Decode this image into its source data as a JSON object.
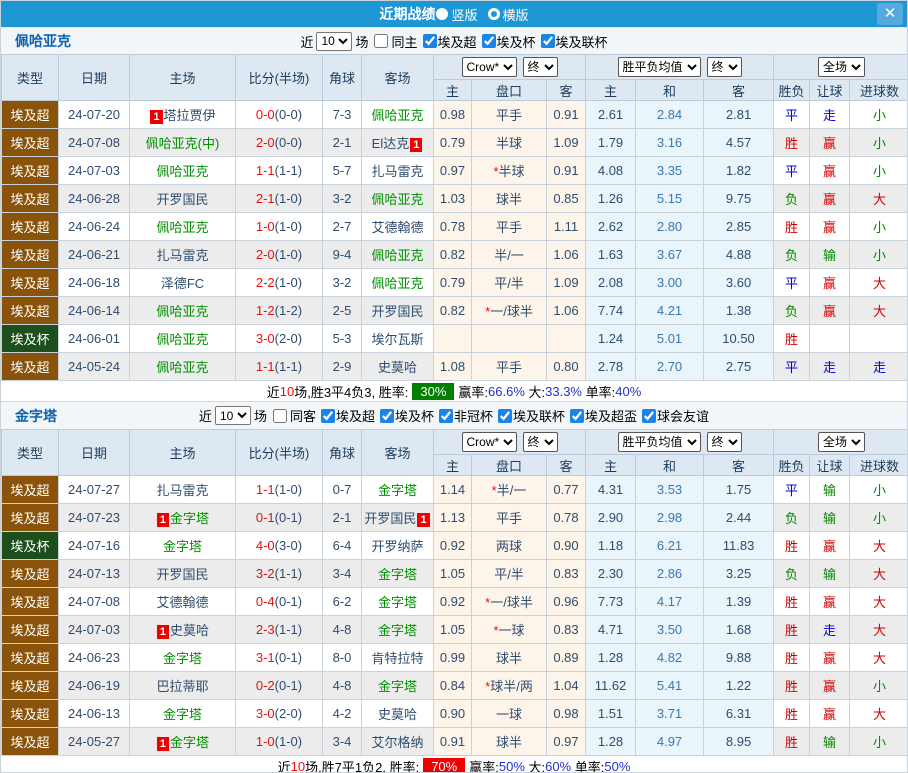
{
  "titlebar": {
    "title": "近期战绩",
    "radio_vertical": "竖版",
    "radio_horizontal": "横版",
    "close": "X"
  },
  "colors": {
    "titlebar_bg": "#1d96d4",
    "type_super_bg": "#8a530a",
    "type_cup_bg": "#1c4f1c",
    "team_green": "#009000",
    "score_red": "#e81010",
    "win_rate_green_bg": "#008000",
    "win_rate_red_bg": "#ee0000",
    "header_bg": "#dde8f2",
    "handicap_col_bg": "#fdf4ea",
    "avg_col_bg": "#e9f4fb"
  },
  "table_header": {
    "type": "类型",
    "date": "日期",
    "home": "主场",
    "score": "比分(半场)",
    "corner": "角球",
    "away": "客场",
    "odds_select": "Crow*",
    "odds_final_select": "终",
    "sub_home": "主",
    "sub_handicap": "盘口",
    "sub_away": "客",
    "avg_select": "胜平负均值",
    "avg_final_select": "终",
    "avg_home": "主",
    "avg_draw": "和",
    "avg_away": "客",
    "scope_select": "全场",
    "wdl": "胜负",
    "let": "让球",
    "goals": "进球数"
  },
  "sections": [
    {
      "team": "佩哈亚克",
      "filters": {
        "near_label": "近",
        "count": "10",
        "games_label": "场",
        "same_label": "同主",
        "same_checked": false,
        "leagues": [
          {
            "label": "埃及超",
            "checked": true
          },
          {
            "label": "埃及杯",
            "checked": true
          },
          {
            "label": "埃及联杯",
            "checked": true
          }
        ]
      },
      "rows": [
        {
          "type": "埃及超",
          "type_style": "super",
          "date": "24-07-20",
          "home": {
            "name": "塔拉贾伊",
            "badge": "1",
            "badge_pos": "before"
          },
          "score": "0-0",
          "half": "(0-0)",
          "corner": "7-3",
          "away": {
            "name": "佩哈亚克",
            "green": true
          },
          "odds_home": "0.98",
          "handicap": "平手",
          "handicap_star": false,
          "odds_away": "0.91",
          "avg_home": "2.61",
          "avg_draw": "2.84",
          "avg_away": "2.81",
          "wdl": "平",
          "let": "走",
          "goal": "小"
        },
        {
          "type": "埃及超",
          "type_style": "super",
          "date": "24-07-08",
          "home": {
            "name": "佩哈亚克(中)",
            "green": true
          },
          "score": "2-0",
          "half": "(0-0)",
          "corner": "2-1",
          "away": {
            "name": "El达克",
            "badge": "1",
            "badge_pos": "after"
          },
          "odds_home": "0.79",
          "handicap": "半球",
          "handicap_star": false,
          "odds_away": "1.09",
          "avg_home": "1.79",
          "avg_draw": "3.16",
          "avg_away": "4.57",
          "wdl": "胜",
          "let": "赢",
          "goal": "小"
        },
        {
          "type": "埃及超",
          "type_style": "super",
          "date": "24-07-03",
          "home": {
            "name": "佩哈亚克",
            "green": true
          },
          "score": "1-1",
          "half": "(1-1)",
          "corner": "5-7",
          "away": {
            "name": "扎马雷克"
          },
          "odds_home": "0.97",
          "handicap": "半球",
          "handicap_star": true,
          "odds_away": "0.91",
          "avg_home": "4.08",
          "avg_draw": "3.35",
          "avg_away": "1.82",
          "wdl": "平",
          "let": "赢",
          "goal": "小"
        },
        {
          "type": "埃及超",
          "type_style": "super",
          "date": "24-06-28",
          "home": {
            "name": "开罗国民"
          },
          "score": "2-1",
          "half": "(1-0)",
          "corner": "3-2",
          "away": {
            "name": "佩哈亚克",
            "green": true
          },
          "odds_home": "1.03",
          "handicap": "球半",
          "handicap_star": false,
          "odds_away": "0.85",
          "avg_home": "1.26",
          "avg_draw": "5.15",
          "avg_away": "9.75",
          "wdl": "负",
          "let": "赢",
          "goal": "大"
        },
        {
          "type": "埃及超",
          "type_style": "super",
          "date": "24-06-24",
          "home": {
            "name": "佩哈亚克",
            "green": true
          },
          "score": "1-0",
          "half": "(1-0)",
          "corner": "2-7",
          "away": {
            "name": "艾德翰德"
          },
          "odds_home": "0.78",
          "handicap": "平手",
          "handicap_star": false,
          "odds_away": "1.11",
          "avg_home": "2.62",
          "avg_draw": "2.80",
          "avg_away": "2.85",
          "wdl": "胜",
          "let": "赢",
          "goal": "小"
        },
        {
          "type": "埃及超",
          "type_style": "super",
          "date": "24-06-21",
          "home": {
            "name": "扎马雷克"
          },
          "score": "2-0",
          "half": "(1-0)",
          "corner": "9-4",
          "away": {
            "name": "佩哈亚克",
            "green": true
          },
          "odds_home": "0.82",
          "handicap": "半/一",
          "handicap_star": false,
          "odds_away": "1.06",
          "avg_home": "1.63",
          "avg_draw": "3.67",
          "avg_away": "4.88",
          "wdl": "负",
          "let": "输",
          "goal": "小"
        },
        {
          "type": "埃及超",
          "type_style": "super",
          "date": "24-06-18",
          "home": {
            "name": "泽德FC"
          },
          "score": "2-2",
          "half": "(1-0)",
          "corner": "3-2",
          "away": {
            "name": "佩哈亚克",
            "green": true
          },
          "odds_home": "0.79",
          "handicap": "平/半",
          "handicap_star": false,
          "odds_away": "1.09",
          "avg_home": "2.08",
          "avg_draw": "3.00",
          "avg_away": "3.60",
          "wdl": "平",
          "let": "赢",
          "goal": "大"
        },
        {
          "type": "埃及超",
          "type_style": "super",
          "date": "24-06-14",
          "home": {
            "name": "佩哈亚克",
            "green": true
          },
          "score": "1-2",
          "half": "(1-2)",
          "corner": "2-5",
          "away": {
            "name": "开罗国民"
          },
          "odds_home": "0.82",
          "handicap": "一/球半",
          "handicap_star": true,
          "odds_away": "1.06",
          "avg_home": "7.74",
          "avg_draw": "4.21",
          "avg_away": "1.38",
          "wdl": "负",
          "let": "赢",
          "goal": "大"
        },
        {
          "type": "埃及杯",
          "type_style": "cup",
          "date": "24-06-01",
          "home": {
            "name": "佩哈亚克",
            "green": true
          },
          "score": "3-0",
          "half": "(2-0)",
          "corner": "5-3",
          "away": {
            "name": "埃尔瓦斯"
          },
          "odds_home": "",
          "handicap": "",
          "handicap_star": false,
          "odds_away": "",
          "avg_home": "1.24",
          "avg_draw": "5.01",
          "avg_away": "10.50",
          "wdl": "胜",
          "let": "",
          "goal": ""
        },
        {
          "type": "埃及超",
          "type_style": "super",
          "date": "24-05-24",
          "home": {
            "name": "佩哈亚克",
            "green": true
          },
          "score": "1-1",
          "half": "(1-1)",
          "corner": "2-9",
          "away": {
            "name": "史莫哈"
          },
          "odds_home": "1.08",
          "handicap": "平手",
          "handicap_star": false,
          "odds_away": "0.80",
          "avg_home": "2.78",
          "avg_draw": "2.70",
          "avg_away": "2.75",
          "wdl": "平",
          "let": "走",
          "goal": "走"
        }
      ],
      "summary": [
        {
          "t": "近",
          "c": ""
        },
        {
          "t": "10",
          "c": "c-red"
        },
        {
          "t": "场,胜3平4负3, 胜率:",
          "c": ""
        },
        {
          "t": "30%",
          "c": "badge-green"
        },
        {
          "t": "赢率:",
          "c": ""
        },
        {
          "t": "66.6%",
          "c": "c-blue"
        },
        {
          "t": " 大:",
          "c": ""
        },
        {
          "t": "33.3%",
          "c": "c-blue"
        },
        {
          "t": " 单率:",
          "c": ""
        },
        {
          "t": "40%",
          "c": "c-blue"
        }
      ]
    },
    {
      "team": "金字塔",
      "filters": {
        "near_label": "近",
        "count": "10",
        "games_label": "场",
        "same_label": "同客",
        "same_checked": false,
        "leagues": [
          {
            "label": "埃及超",
            "checked": true
          },
          {
            "label": "埃及杯",
            "checked": true
          },
          {
            "label": "非冠杯",
            "checked": true
          },
          {
            "label": "埃及联杯",
            "checked": true
          },
          {
            "label": "埃及超盃",
            "checked": true
          },
          {
            "label": "球会友谊",
            "checked": true
          }
        ]
      },
      "rows": [
        {
          "type": "埃及超",
          "type_style": "super",
          "date": "24-07-27",
          "home": {
            "name": "扎马雷克"
          },
          "score": "1-1",
          "half": "(1-0)",
          "corner": "0-7",
          "away": {
            "name": "金字塔",
            "green": true
          },
          "odds_home": "1.14",
          "handicap": "半/一",
          "handicap_star": true,
          "odds_away": "0.77",
          "avg_home": "4.31",
          "avg_draw": "3.53",
          "avg_away": "1.75",
          "wdl": "平",
          "let": "输",
          "goal": "小"
        },
        {
          "type": "埃及超",
          "type_style": "super",
          "date": "24-07-23",
          "home": {
            "name": "金字塔",
            "green": true,
            "badge": "1",
            "badge_pos": "before"
          },
          "score": "0-1",
          "half": "(0-1)",
          "corner": "2-1",
          "away": {
            "name": "开罗国民",
            "badge": "1",
            "badge_pos": "after"
          },
          "odds_home": "1.13",
          "handicap": "平手",
          "handicap_star": false,
          "odds_away": "0.78",
          "avg_home": "2.90",
          "avg_draw": "2.98",
          "avg_away": "2.44",
          "wdl": "负",
          "let": "输",
          "goal": "小"
        },
        {
          "type": "埃及杯",
          "type_style": "cup",
          "date": "24-07-16",
          "home": {
            "name": "金字塔",
            "green": true
          },
          "score": "4-0",
          "half": "(3-0)",
          "corner": "6-4",
          "away": {
            "name": "开罗纳萨"
          },
          "odds_home": "0.92",
          "handicap": "两球",
          "handicap_star": false,
          "odds_away": "0.90",
          "avg_home": "1.18",
          "avg_draw": "6.21",
          "avg_away": "11.83",
          "wdl": "胜",
          "let": "赢",
          "goal": "大"
        },
        {
          "type": "埃及超",
          "type_style": "super",
          "date": "24-07-13",
          "home": {
            "name": "开罗国民"
          },
          "score": "3-2",
          "half": "(1-1)",
          "corner": "3-4",
          "away": {
            "name": "金字塔",
            "green": true
          },
          "odds_home": "1.05",
          "handicap": "平/半",
          "handicap_star": false,
          "odds_away": "0.83",
          "avg_home": "2.30",
          "avg_draw": "2.86",
          "avg_away": "3.25",
          "wdl": "负",
          "let": "输",
          "goal": "大"
        },
        {
          "type": "埃及超",
          "type_style": "super",
          "date": "24-07-08",
          "home": {
            "name": "艾德翰德"
          },
          "score": "0-4",
          "half": "(0-1)",
          "corner": "6-2",
          "away": {
            "name": "金字塔",
            "green": true
          },
          "odds_home": "0.92",
          "handicap": "一/球半",
          "handicap_star": true,
          "odds_away": "0.96",
          "avg_home": "7.73",
          "avg_draw": "4.17",
          "avg_away": "1.39",
          "wdl": "胜",
          "let": "赢",
          "goal": "大"
        },
        {
          "type": "埃及超",
          "type_style": "super",
          "date": "24-07-03",
          "home": {
            "name": "史莫哈",
            "badge": "1",
            "badge_pos": "before"
          },
          "score": "2-3",
          "half": "(1-1)",
          "corner": "4-8",
          "away": {
            "name": "金字塔",
            "green": true
          },
          "odds_home": "1.05",
          "handicap": "一球",
          "handicap_star": true,
          "odds_away": "0.83",
          "avg_home": "4.71",
          "avg_draw": "3.50",
          "avg_away": "1.68",
          "wdl": "胜",
          "let": "走",
          "goal": "大"
        },
        {
          "type": "埃及超",
          "type_style": "super",
          "date": "24-06-23",
          "home": {
            "name": "金字塔",
            "green": true
          },
          "score": "3-1",
          "half": "(0-1)",
          "corner": "8-0",
          "away": {
            "name": "肯特拉特"
          },
          "odds_home": "0.99",
          "handicap": "球半",
          "handicap_star": false,
          "odds_away": "0.89",
          "avg_home": "1.28",
          "avg_draw": "4.82",
          "avg_away": "9.88",
          "wdl": "胜",
          "let": "赢",
          "goal": "大"
        },
        {
          "type": "埃及超",
          "type_style": "super",
          "date": "24-06-19",
          "home": {
            "name": "巴拉蒂耶"
          },
          "score": "0-2",
          "half": "(0-1)",
          "corner": "4-8",
          "away": {
            "name": "金字塔",
            "green": true
          },
          "odds_home": "0.84",
          "handicap": "球半/两",
          "handicap_star": true,
          "odds_away": "1.04",
          "avg_home": "11.62",
          "avg_draw": "5.41",
          "avg_away": "1.22",
          "wdl": "胜",
          "let": "赢",
          "goal": "小"
        },
        {
          "type": "埃及超",
          "type_style": "super",
          "date": "24-06-13",
          "home": {
            "name": "金字塔",
            "green": true
          },
          "score": "3-0",
          "half": "(2-0)",
          "corner": "4-2",
          "away": {
            "name": "史莫哈"
          },
          "odds_home": "0.90",
          "handicap": "一球",
          "handicap_star": false,
          "odds_away": "0.98",
          "avg_home": "1.51",
          "avg_draw": "3.71",
          "avg_away": "6.31",
          "wdl": "胜",
          "let": "赢",
          "goal": "大"
        },
        {
          "type": "埃及超",
          "type_style": "super",
          "date": "24-05-27",
          "home": {
            "name": "金字塔",
            "green": true,
            "badge": "1",
            "badge_pos": "before"
          },
          "score": "1-0",
          "half": "(1-0)",
          "corner": "3-4",
          "away": {
            "name": "艾尔格纳"
          },
          "odds_home": "0.91",
          "handicap": "球半",
          "handicap_star": false,
          "odds_away": "0.97",
          "avg_home": "1.28",
          "avg_draw": "4.97",
          "avg_away": "8.95",
          "wdl": "胜",
          "let": "输",
          "goal": "小"
        }
      ],
      "summary": [
        {
          "t": "近",
          "c": ""
        },
        {
          "t": "10",
          "c": "c-red"
        },
        {
          "t": "场,胜7平1负2, 胜率:",
          "c": ""
        },
        {
          "t": "70%",
          "c": "badge-red"
        },
        {
          "t": "赢率:",
          "c": ""
        },
        {
          "t": "50%",
          "c": "c-blue"
        },
        {
          "t": " 大:",
          "c": ""
        },
        {
          "t": "60%",
          "c": "c-blue"
        },
        {
          "t": " 单率:",
          "c": ""
        },
        {
          "t": "50%",
          "c": "c-blue"
        }
      ]
    }
  ]
}
